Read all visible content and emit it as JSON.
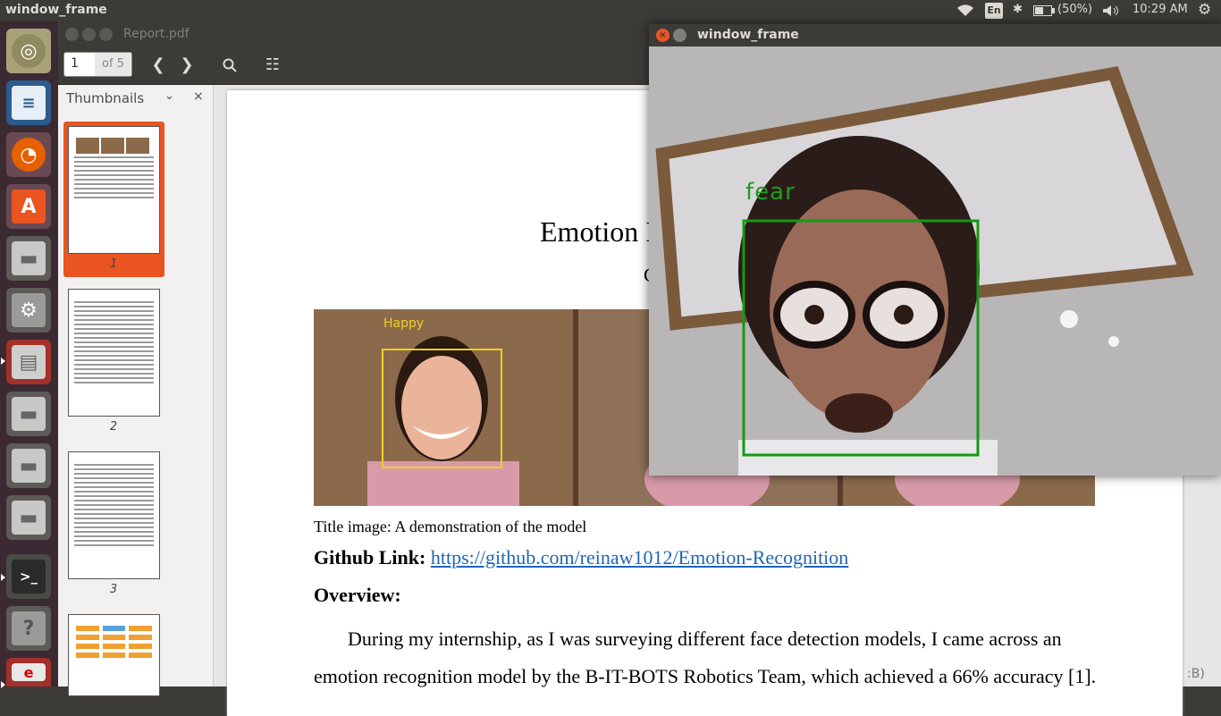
{
  "top_panel": {
    "app_title": "window_frame",
    "lang": "En",
    "battery": "(50%)",
    "clock": "10:29 AM"
  },
  "launcher": {
    "items": [
      "ubuntu-dash",
      "libreoffice-writer",
      "firefox",
      "software-center",
      "disk-drive",
      "system-settings",
      "file-manager",
      "disk-drive",
      "disk-drive",
      "disk-drive",
      "terminal",
      "help"
    ]
  },
  "viewer": {
    "title": "Report.pdf",
    "page_number": "1",
    "page_count": "of 5",
    "sidebar_label": "Thumbnails",
    "thumbnails": [
      "1",
      "2",
      "3"
    ],
    "page": {
      "title_visible": "Emotion I",
      "subtitle_visible": "C",
      "image_label": "Happy",
      "caption": "Title image: A demonstration of the model",
      "github_label": "Github Link:",
      "github_url": "https://github.com/reinaw1012/Emotion-Recognition",
      "overview_heading": "Overview:",
      "paragraph": "During my internship, as I was surveying different face detection models, I came across an emotion recognition model by the B-IT-BOTS Robotics Team, which achieved a 66% accuracy [1]."
    },
    "cut_text": ":B)"
  },
  "camera_window": {
    "title": "window_frame",
    "emotion_label": "fear",
    "label_color": "#1e9e1e"
  }
}
